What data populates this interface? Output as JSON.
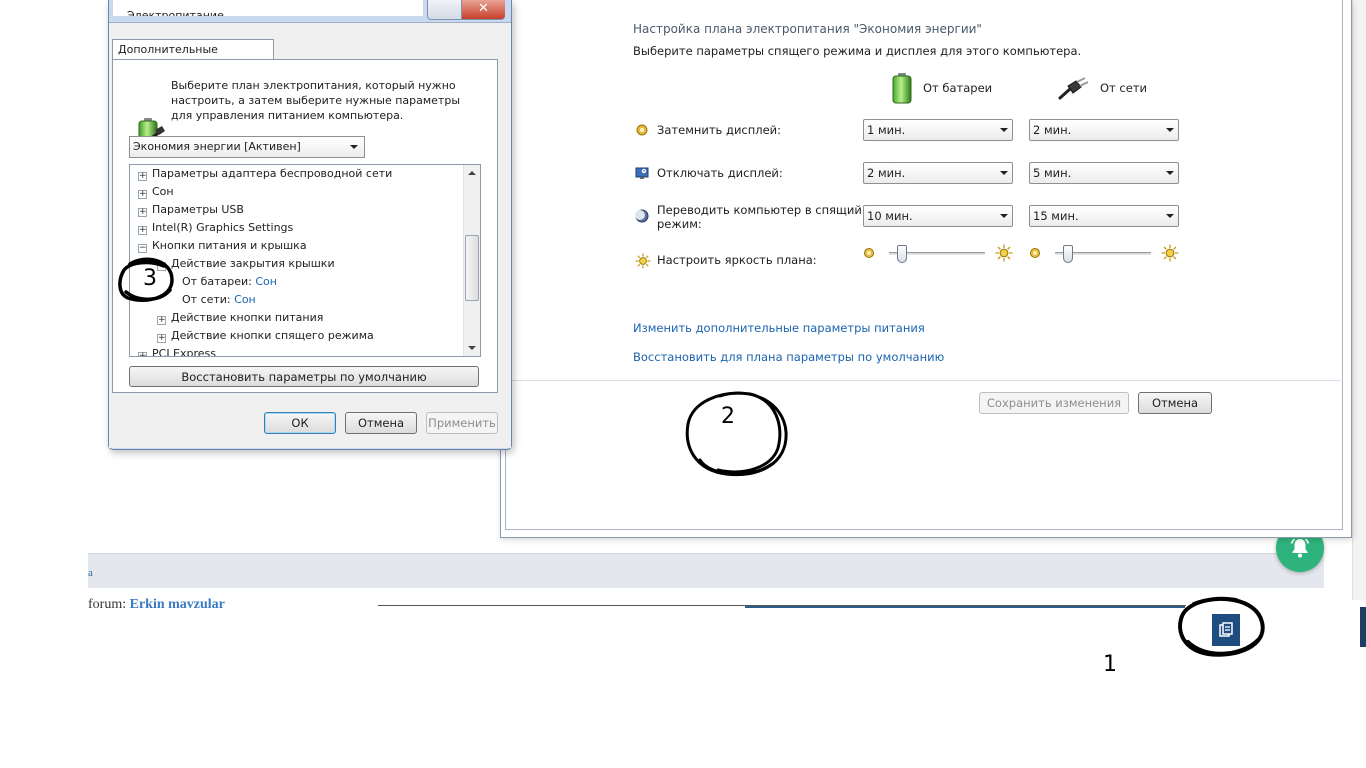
{
  "plan_window": {
    "heading": "Настройка плана электропитания \"Экономия энергии\"",
    "subheading": "Выберите параметры спящего режима и дисплея для этого компьютера.",
    "col_battery": "От батареи",
    "col_ac": "От сети",
    "rows": [
      {
        "label": "Затемнить дисплей:",
        "battery": "1 мин.",
        "ac": "2 мин."
      },
      {
        "label": "Отключать дисплей:",
        "battery": "2 мин.",
        "ac": "5 мин."
      },
      {
        "label_line1": "Переводить компьютер в спящий",
        "label_line2": "режим:",
        "battery": "10 мин.",
        "ac": "15 мин."
      }
    ],
    "brightness_label": "Настроить яркость плана:",
    "brightness_battery": 0.14,
    "brightness_ac": 0.14,
    "link_advanced": "Изменить дополнительные параметры питания",
    "link_restore": "Восстановить для плана параметры по умолчанию",
    "btn_save": "Сохранить изменения",
    "btn_cancel": "Отмена"
  },
  "adv_dialog": {
    "title": "Электропитание",
    "tab_label": "Дополнительные параметры",
    "description": "Выберите план электропитания, который нужно настроить, а затем выберите нужные параметры для управления питанием компьютера.",
    "plan_selected": "Экономия энергии [Активен]",
    "tree": [
      {
        "level": 0,
        "expander": "+",
        "text": "Параметры адаптера беспроводной сети"
      },
      {
        "level": 0,
        "expander": "+",
        "text": "Сон"
      },
      {
        "level": 0,
        "expander": "+",
        "text": "Параметры USB"
      },
      {
        "level": 0,
        "expander": "+",
        "text": "Intel(R) Graphics Settings"
      },
      {
        "level": 0,
        "expander": "−",
        "text": "Кнопки питания и крышка"
      },
      {
        "level": 1,
        "expander": "−",
        "text": "Действие закрытия крышки"
      },
      {
        "level": 2,
        "expander": "",
        "text": "От батареи:",
        "value": "Сон"
      },
      {
        "level": 2,
        "expander": "",
        "text": "От сети:",
        "value": "Сон"
      },
      {
        "level": 1,
        "expander": "+",
        "text": "Действие кнопки питания"
      },
      {
        "level": 1,
        "expander": "+",
        "text": "Действие кнопки спящего режима"
      },
      {
        "level": 0,
        "expander": "+",
        "text": "PCI Express"
      }
    ],
    "btn_restore": "Восстановить параметры по умолчанию",
    "btn_ok": "ОК",
    "btn_cancel": "Отмена",
    "btn_apply": "Применить"
  },
  "background_page": {
    "bar_text": "a",
    "forum_prefix": "forum: ",
    "forum_name": "Erkin mavzular"
  },
  "annotations": {
    "one": "1",
    "two": "2",
    "three": "3"
  },
  "icons": {
    "bell": "bell-icon",
    "copy": "copy-icon",
    "battery": "battery-icon",
    "plug": "plug-icon"
  },
  "colors": {
    "link": "#1a63b0",
    "bell_bg": "#2fb37d",
    "copy_bg": "#1f4d80"
  }
}
